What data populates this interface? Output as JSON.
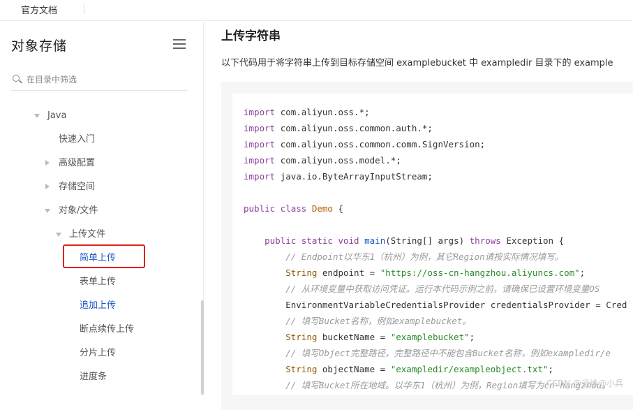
{
  "topbar": {
    "official_docs": "官方文档"
  },
  "sidebar": {
    "title": "对象存储",
    "filter_placeholder": "在目录中筛选",
    "items": [
      {
        "label": "Java"
      },
      {
        "label": "快速入门"
      },
      {
        "label": "高级配置"
      },
      {
        "label": "存储空间"
      },
      {
        "label": "对象/文件"
      },
      {
        "label": "上传文件"
      },
      {
        "label": "简单上传"
      },
      {
        "label": "表单上传"
      },
      {
        "label": "追加上传"
      },
      {
        "label": "断点续传上传"
      },
      {
        "label": "分片上传"
      },
      {
        "label": "进度条"
      }
    ]
  },
  "content": {
    "heading": "上传字符串",
    "description": "以下代码用于将字符串上传到目标存储空间 examplebucket 中 exampledir 目录下的 example",
    "code": {
      "l1": "com.aliyun.oss.*;",
      "l2": "com.aliyun.oss.common.auth.*;",
      "l3": "com.aliyun.oss.common.comm.SignVersion;",
      "l4": "com.aliyun.oss.model.*;",
      "l5": "java.io.ByteArrayInputStream;",
      "kw_import": "import",
      "kw_public": "public",
      "kw_class": "class",
      "class_name": "Demo",
      "brace_open": "{",
      "kw_static": "static",
      "kw_void": "void",
      "main": "main",
      "main_args": "(String[] args)",
      "kw_throws": "throws",
      "exception": "Exception {",
      "c1": "// Endpoint以华东1（杭州）为例，其它Region请按实际情况填写。",
      "endpoint_type": "String",
      "endpoint_var": " endpoint = ",
      "endpoint_val": "\"https://oss-cn-hangzhou.aliyuncs.com\"",
      "semi": ";",
      "c2": "// 从环境变量中获取访问凭证。运行本代码示例之前，请确保已设置环境变量OS",
      "creds_line": "EnvironmentVariableCredentialsProvider credentialsProvider = Cred",
      "c3": "// 填写Bucket名称，例如examplebucket。",
      "bucket_var": " bucketName = ",
      "bucket_val": "\"examplebucket\"",
      "c4": "// 填写Object完整路径，完整路径中不能包含Bucket名称，例如exampledir/e",
      "object_var": " objectName = ",
      "object_val": "\"exampledir/exampleobject.txt\"",
      "c5": "// 填写Bucket所在地域。以华东1（杭州）为例，Region填写为cn-hangzhou。"
    },
    "watermark": "CSDN @运维@小兵"
  }
}
